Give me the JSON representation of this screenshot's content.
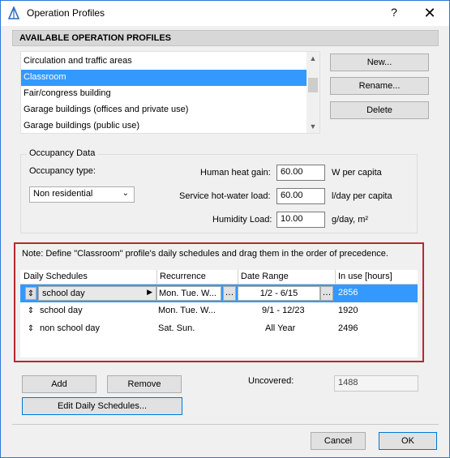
{
  "window": {
    "title": "Operation Profiles",
    "help_label": "?",
    "close_label": "✕"
  },
  "profiles": {
    "header": "AVAILABLE OPERATION PROFILES",
    "items": [
      {
        "label": "Circulation and traffic areas",
        "selected": false
      },
      {
        "label": "Classroom",
        "selected": true
      },
      {
        "label": "Fair/congress building",
        "selected": false
      },
      {
        "label": "Garage buildings (offices and private use)",
        "selected": false
      },
      {
        "label": "Garage buildings (public use)",
        "selected": false
      }
    ],
    "buttons": {
      "new": "New...",
      "rename": "Rename...",
      "delete": "Delete"
    }
  },
  "occupancy": {
    "legend": "Occupancy Data",
    "type_label": "Occupancy type:",
    "type_value": "Non residential",
    "heat_gain_label": "Human heat gain:",
    "heat_gain_value": "60.00",
    "heat_gain_unit": "W per capita",
    "hot_water_label": "Service hot-water load:",
    "hot_water_value": "60.00",
    "hot_water_unit": "l/day per capita",
    "humidity_label": "Humidity Load:",
    "humidity_value": "10.00",
    "humidity_unit": "g/day, m²"
  },
  "schedules": {
    "note": "Note: Define \"Classroom\" profile's daily schedules and drag them in the order of precedence.",
    "columns": [
      "Daily Schedules",
      "Recurrence",
      "Date Range",
      "In use [hours]"
    ],
    "rows": [
      {
        "name": "school day",
        "recurrence": "Mon. Tue. W...",
        "date_range": "1/2 - 6/15",
        "hours": "2856",
        "selected": true
      },
      {
        "name": "school day",
        "recurrence": "Mon. Tue. W...",
        "date_range": "9/1 - 12/23",
        "hours": "1920",
        "selected": false
      },
      {
        "name": "non school day",
        "recurrence": "Sat. Sun.",
        "date_range": "All Year",
        "hours": "2496",
        "selected": false
      }
    ],
    "add_label": "Add",
    "remove_label": "Remove",
    "edit_label": "Edit Daily Schedules...",
    "uncovered_label": "Uncovered:",
    "uncovered_value": "1488"
  },
  "footer": {
    "cancel_label": "Cancel",
    "ok_label": "OK"
  },
  "colors": {
    "selection": "#3399ff",
    "highlight_frame": "#b7282e",
    "accent": "#0078d7"
  }
}
